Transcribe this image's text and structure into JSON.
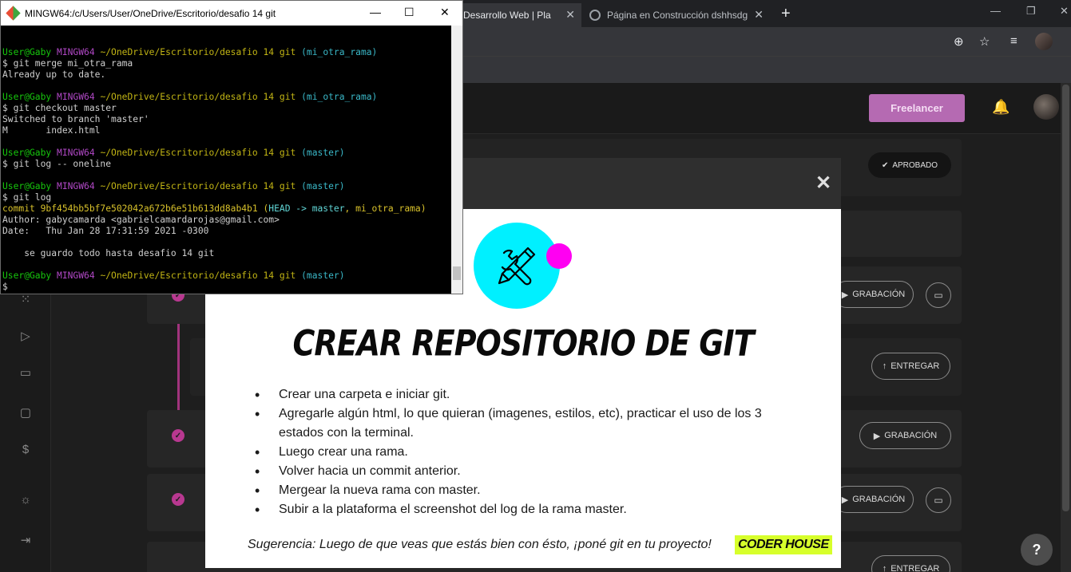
{
  "browser": {
    "tabs": [
      {
        "title": "e Desarrollo Web | Pla"
      },
      {
        "title": "Página en Construcción dshhsdg"
      }
    ]
  },
  "terminal": {
    "title": "MINGW64:/c/Users/User/OneDrive/Escritorio/desafio 14 git",
    "prompt_user": "User@Gaby",
    "prompt_host": "MINGW64",
    "prompt_path": "~/OneDrive/Escritorio/desafio 14 git",
    "blocks": [
      {
        "branch": "(mi_otra_rama)",
        "command": "$ git merge mi_otra_rama",
        "output": [
          "Already up to date."
        ]
      },
      {
        "branch": "(mi_otra_rama)",
        "command": "$ git checkout master",
        "output": [
          "Switched to branch 'master'",
          "M       index.html"
        ]
      },
      {
        "branch": "(master)",
        "command": "$ git log -- oneline",
        "output": []
      },
      {
        "branch": "(master)",
        "command": "$ git log",
        "output": []
      }
    ],
    "commit_hash": "commit 9bf454bb5bf7e502042a672b6e51b613dd8ab4b1",
    "commit_refs_open": "(",
    "commit_head": "HEAD -> master",
    "commit_refs_rest": ", mi_otra_rama",
    "commit_refs_close": ")",
    "author": "Author: gabycamarda <gabrielcamardarojas@gmail.com>",
    "date": "Date:   Thu Jan 28 17:31:59 2021 -0300",
    "message": "    se guardo todo hasta desafio 14 git",
    "final_branch": "(master)",
    "final_prompt": "$"
  },
  "header": {
    "freelancer_label": "Freelancer"
  },
  "status": {
    "aprobado_label": "APROBADO"
  },
  "actions": {
    "grabacion_1": "GRABACIÓN",
    "entregar_1": "ENTREGAR",
    "grabacion_2": "GRABACIÓN",
    "grabacion_3": "GRABACIÓN",
    "entregar_2": "ENTREGAR"
  },
  "help_label": "?",
  "modal": {
    "title": "CREAR REPOSITORIO DE GIT",
    "bullets": [
      "Crear una carpeta e iniciar git.",
      "Agregarle algún html, lo que quieran (imagenes, estilos, etc), practicar el uso de los 3 estados con la terminal.",
      "Luego crear una rama.",
      "Volver hacia un commit anterior.",
      "Mergear la nueva rama con master.",
      "Subir a la plataforma el screenshot del log de la rama master."
    ],
    "tip": "Sugerencia:  Luego de que veas que estás bien con ésto, ¡poné git en tu proyecto!",
    "brand": "CODER HOUSE",
    "colors": {
      "hero_circle": "#00f0ff",
      "accent_dot": "#ff00f2",
      "brand_bg": "#d7ff2b"
    }
  },
  "theme": {
    "accent": "#b83890",
    "freelancer_bg": "#b56ab2"
  }
}
